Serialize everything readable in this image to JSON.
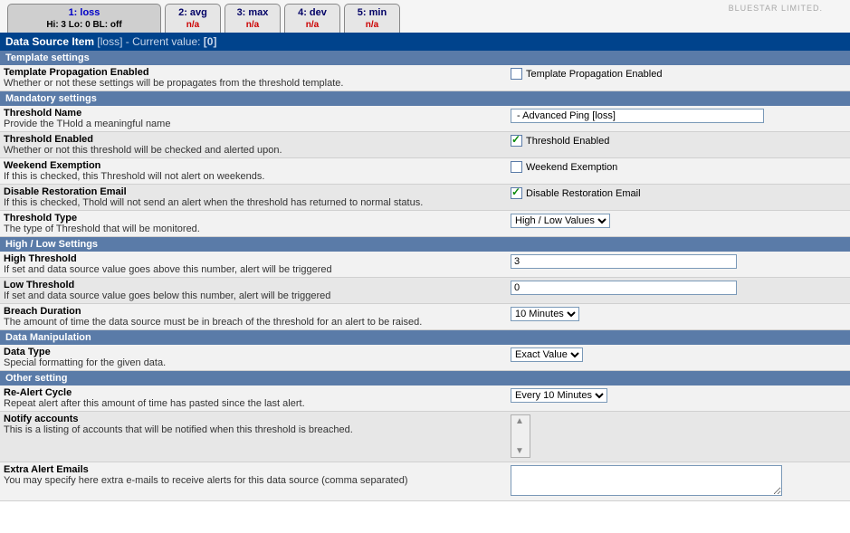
{
  "brand": "BLUESTAR LIMITED.",
  "tabs": [
    {
      "line1": "1: loss",
      "line2": "Hi: 3 Lo: 0 BL: off",
      "active": true
    },
    {
      "line1": "2: avg",
      "line2": "n/a",
      "active": false
    },
    {
      "line1": "3: max",
      "line2": "n/a",
      "active": false
    },
    {
      "line1": "4: dev",
      "line2": "n/a",
      "active": false
    },
    {
      "line1": "5: min",
      "line2": "n/a",
      "active": false
    }
  ],
  "header": {
    "prefix": "Data Source Item",
    "item": "[loss]",
    "mid": "- Current value:",
    "value": "[0]"
  },
  "sections": {
    "template": "Template settings",
    "mandatory": "Mandatory settings",
    "highlow": "High / Low Settings",
    "datamanip": "Data Manipulation",
    "other": "Other setting"
  },
  "rows": {
    "tpe": {
      "title": "Template Propagation Enabled",
      "desc": "Whether or not these settings will be propagates from the threshold template.",
      "checkbox_label": "Template Propagation Enabled",
      "checked": false
    },
    "tname": {
      "title": "Threshold Name",
      "desc": "Provide the THold a meaningful name",
      "value": " - Advanced Ping [loss]"
    },
    "tenabled": {
      "title": "Threshold Enabled",
      "desc": "Whether or not this threshold will be checked and alerted upon.",
      "checkbox_label": "Threshold Enabled",
      "checked": true
    },
    "weekend": {
      "title": "Weekend Exemption",
      "desc": "If this is checked, this Threshold will not alert on weekends.",
      "checkbox_label": "Weekend Exemption",
      "checked": false
    },
    "restore": {
      "title": "Disable Restoration Email",
      "desc": "If this is checked, Thold will not send an alert when the threshold has returned to normal status.",
      "checkbox_label": "Disable Restoration Email",
      "checked": true
    },
    "ttype": {
      "title": "Threshold Type",
      "desc": "The type of Threshold that will be monitored.",
      "value": "High / Low Values"
    },
    "hithresh": {
      "title": "High Threshold",
      "desc": "If set and data source value goes above this number, alert will be triggered",
      "value": "3"
    },
    "lothresh": {
      "title": "Low Threshold",
      "desc": "If set and data source value goes below this number, alert will be triggered",
      "value": "0"
    },
    "breach": {
      "title": "Breach Duration",
      "desc": "The amount of time the data source must be in breach of the threshold for an alert to be raised.",
      "value": "10 Minutes"
    },
    "datatype": {
      "title": "Data Type",
      "desc": "Special formatting for the given data.",
      "value": "Exact Value"
    },
    "realert": {
      "title": "Re-Alert Cycle",
      "desc": "Repeat alert after this amount of time has pasted since the last alert.",
      "value": "Every 10 Minutes"
    },
    "notify": {
      "title": "Notify accounts",
      "desc": "This is a listing of accounts that will be notified when this threshold is breached."
    },
    "extra": {
      "title": "Extra Alert Emails",
      "desc": "You may specify here extra e-mails to receive alerts for this data source (comma separated)",
      "value": ""
    }
  }
}
